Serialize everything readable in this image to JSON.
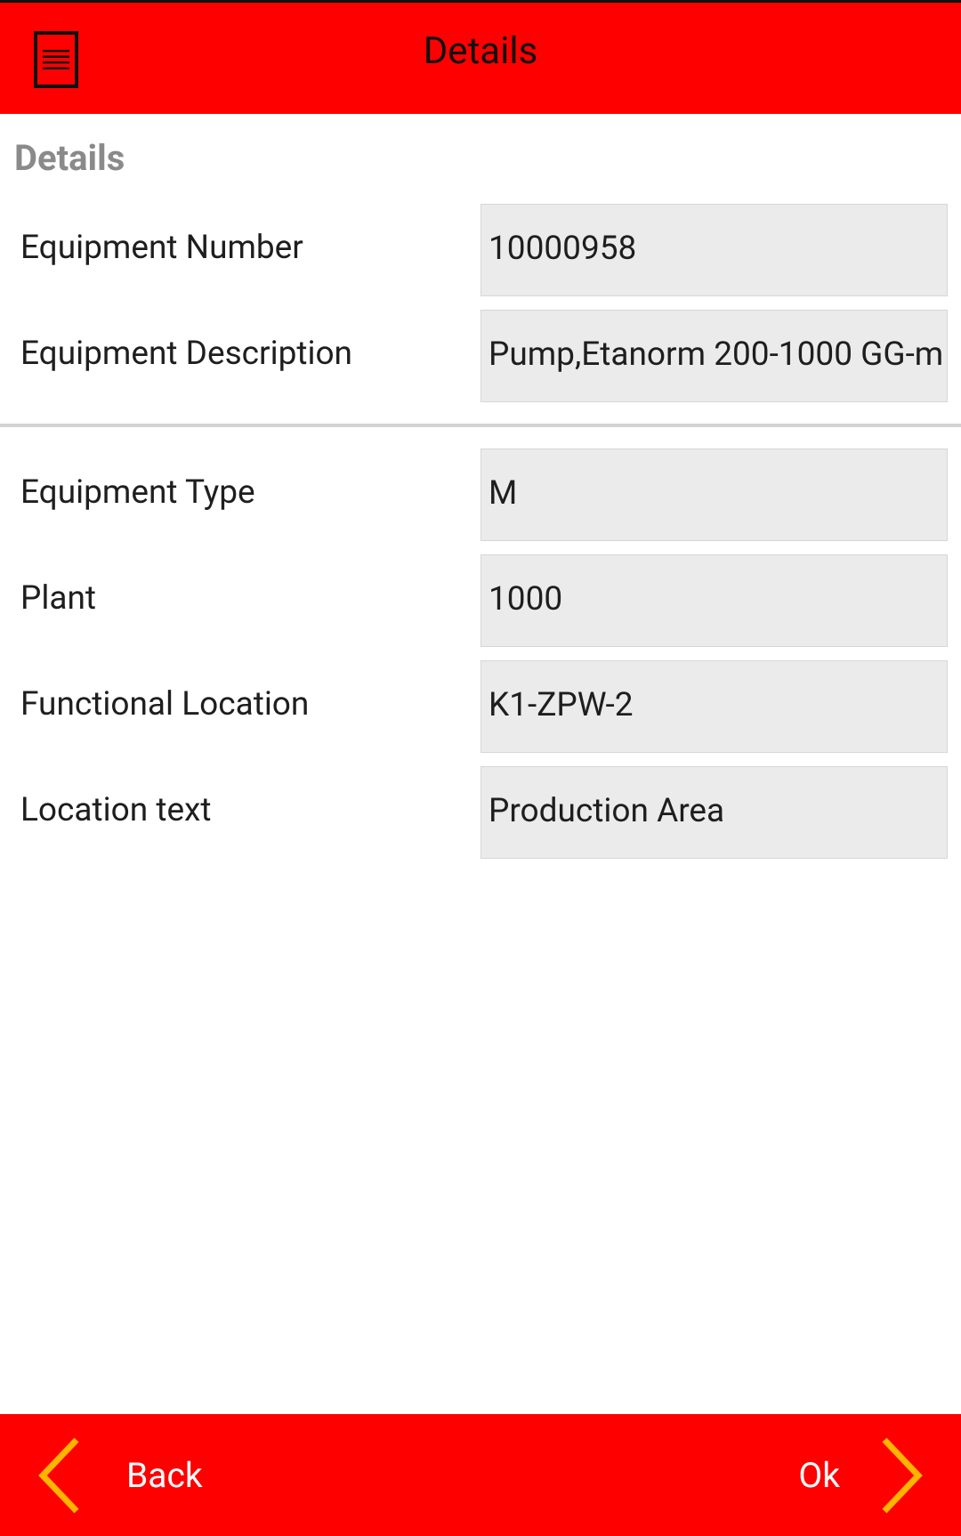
{
  "app_bar": {
    "title": "Details",
    "menu_icon": "document-menu-icon"
  },
  "section": {
    "title": "Details"
  },
  "fields": [
    {
      "label": "Equipment Number",
      "value": "10000958"
    },
    {
      "label": "Equipment Description",
      "value": "Pump,Etanorm 200-1000 GG-m"
    },
    {
      "label": "Equipment Type",
      "value": "M"
    },
    {
      "label": "Plant",
      "value": "1000"
    },
    {
      "label": "Functional Location",
      "value": "K1-ZPW-2"
    },
    {
      "label": "Location text",
      "value": "Production Area"
    }
  ],
  "bottom_bar": {
    "back_label": "Back",
    "ok_label": "Ok",
    "back_icon": "chevron-left-icon",
    "ok_icon": "chevron-right-icon"
  },
  "colors": {
    "bar": "#ff0000",
    "chevron": "#ffb400",
    "field_background": "#ebebeb",
    "section_title": "#8a8a8a"
  }
}
